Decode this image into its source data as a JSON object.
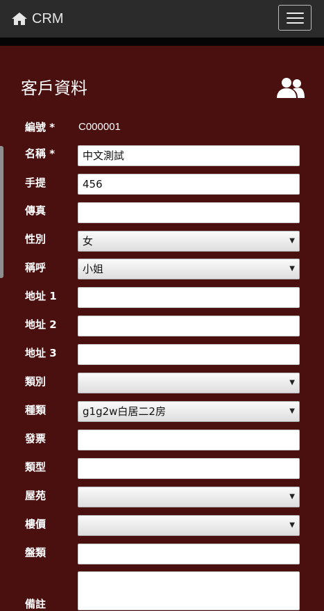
{
  "navbar": {
    "brand": "CRM",
    "home_icon": "home-icon",
    "menu_icon": "hamburger-menu-icon"
  },
  "page": {
    "title": "客戶資料",
    "users_icon": "users-icon"
  },
  "form": {
    "id": {
      "label": "編號 *",
      "value": "C000001"
    },
    "name": {
      "label": "名稱 *",
      "value": "中文測試"
    },
    "mobile": {
      "label": "手提",
      "value": "456"
    },
    "fax": {
      "label": "傳真",
      "value": ""
    },
    "gender": {
      "label": "性別",
      "value": "女"
    },
    "salutation": {
      "label": "稱呼",
      "value": "小姐"
    },
    "address1": {
      "label": "地址 1",
      "value": ""
    },
    "address2": {
      "label": "地址 2",
      "value": ""
    },
    "address3": {
      "label": "地址 3",
      "value": ""
    },
    "category": {
      "label": "類別",
      "value": ""
    },
    "kind": {
      "label": "種類",
      "value": "g1g2w白居二2房"
    },
    "invoice": {
      "label": "發票",
      "value": ""
    },
    "type": {
      "label": "類型",
      "value": ""
    },
    "estate": {
      "label": "屋苑",
      "value": ""
    },
    "price": {
      "label": "樓價",
      "value": ""
    },
    "layout": {
      "label": "盤類",
      "value": ""
    },
    "remarks": {
      "label": "備註",
      "value": ""
    }
  },
  "colors": {
    "background": "#4a0f0f",
    "navbar": "#2b2b2b"
  }
}
